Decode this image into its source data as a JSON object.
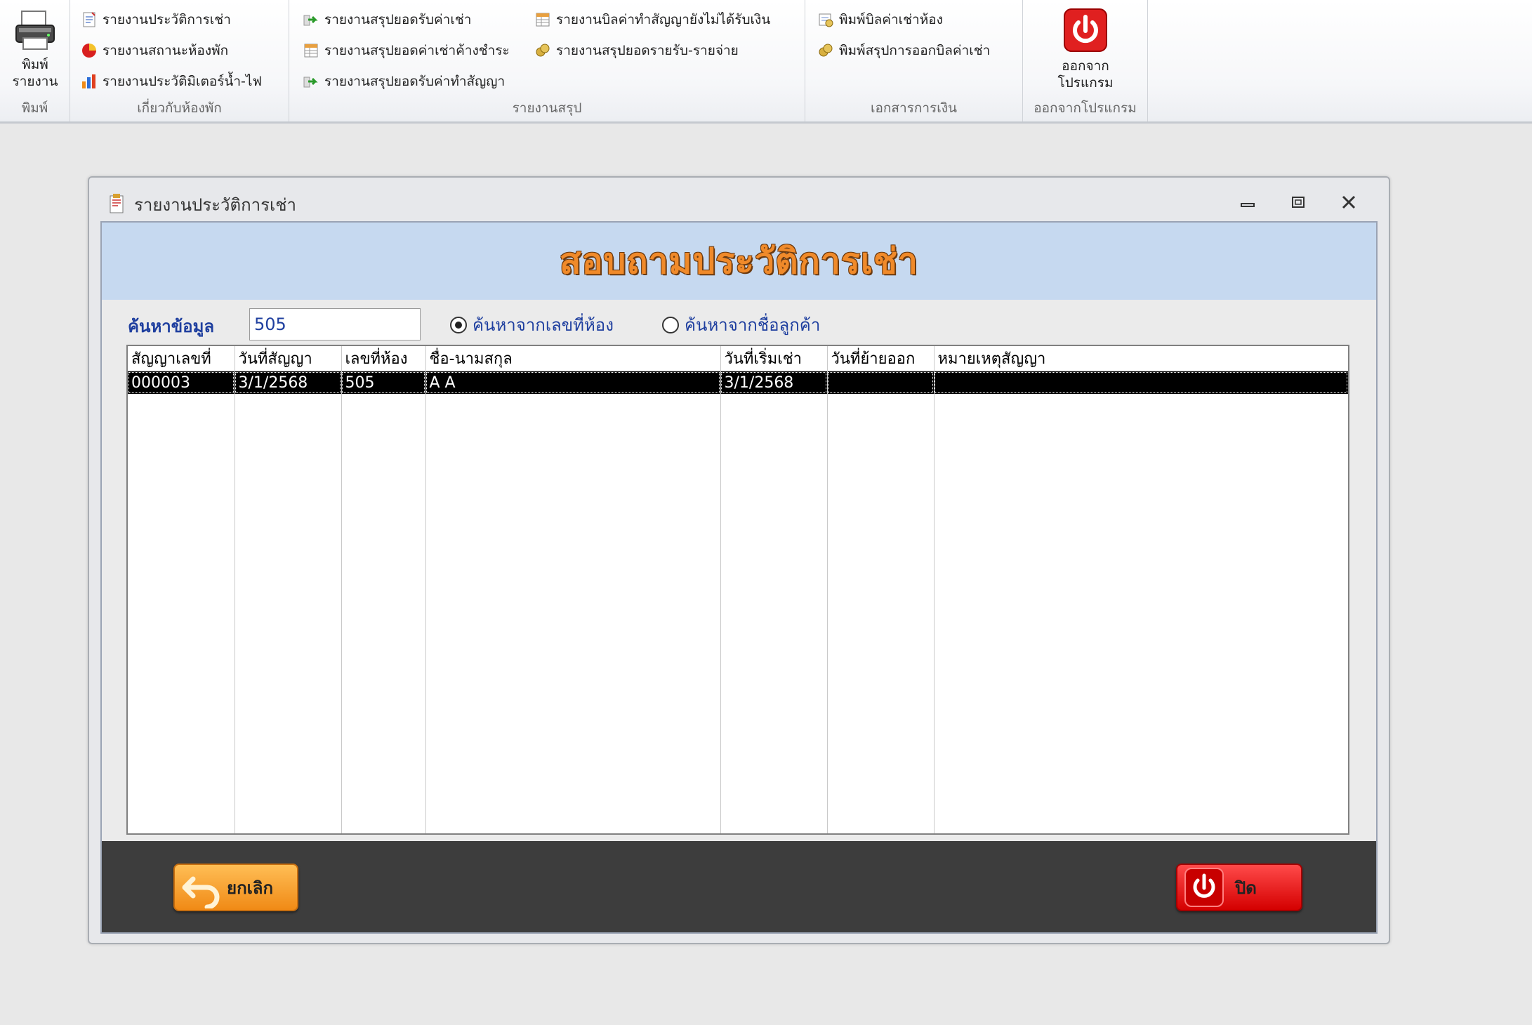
{
  "ribbon": {
    "print_group": {
      "big_button_label_line1": "พิมพ์",
      "big_button_label_line2": "รายงาน",
      "group_label": "พิมพ์"
    },
    "room_group": {
      "items": [
        {
          "label": "รายงานประวัติการเช่า",
          "icon": "document-icon"
        },
        {
          "label": "รายงานสถานะห้องพัก",
          "icon": "status-pie-icon"
        },
        {
          "label": "รายงานประวัติมิเตอร์น้ำ-ไฟ",
          "icon": "bar-chart-icon"
        }
      ],
      "group_label": "เกี่ยวกับห้องพัก"
    },
    "summary_group": {
      "items": [
        {
          "label": "รายงานสรุปยอดรับค่าเช่า",
          "icon": "arrow-right-icon"
        },
        {
          "label": "รายงานสรุปยอดค่าเช่าค้างชำระ",
          "icon": "table-icon"
        },
        {
          "label": "รายงานสรุปยอดรับค่าทำสัญญา",
          "icon": "arrow-right-icon"
        },
        {
          "label": "รายงานบิลค่าทำสัญญายังไม่ได้รับเงิน",
          "icon": "table-icon"
        },
        {
          "label": "รายงานสรุปยอดรายรับ-รายจ่าย",
          "icon": "coins-icon"
        }
      ],
      "group_label": "รายงานสรุป"
    },
    "finance_group": {
      "items": [
        {
          "label": "พิมพ์บิลค่าเช่าห้อง",
          "icon": "bill-icon"
        },
        {
          "label": "พิมพ์สรุปการออกบิลค่าเช่า",
          "icon": "coins-icon"
        }
      ],
      "group_label": "เอกสารการเงิน"
    },
    "exit_group": {
      "big_button_label_line1": "ออกจาก",
      "big_button_label_line2": "โปรแกรม",
      "group_label": "ออกจากโปรแกรม"
    }
  },
  "dialog": {
    "title": "รายงานประวัติการเช่า",
    "header": "สอบถามประวัติการเช่า",
    "search": {
      "label": "ค้นหาข้อมูล",
      "value": "505",
      "radio_room": "ค้นหาจากเลขที่ห้อง",
      "radio_customer": "ค้นหาจากชื่อลูกค้า",
      "selected": "room"
    },
    "grid": {
      "columns": [
        "สัญญาเลขที่",
        "วันที่สัญญา",
        "เลขที่ห้อง",
        "ชื่อ-นามสกุล",
        "วันที่เริ่มเช่า",
        "วันที่ย้ายออก",
        "หมายเหตุสัญญา"
      ],
      "rows": [
        [
          "000003",
          "3/1/2568",
          "505",
          "A A",
          "3/1/2568",
          "",
          ""
        ]
      ]
    },
    "buttons": {
      "cancel": "ยกเลิก",
      "close": "ปิด"
    }
  },
  "colors": {
    "header_band": "#c6d9f0",
    "header_text": "#f08a2a",
    "label_text": "#1f3f9f",
    "footer": "#3d3d3d",
    "cancel_button": "#f08a16",
    "close_button": "#d40000"
  }
}
